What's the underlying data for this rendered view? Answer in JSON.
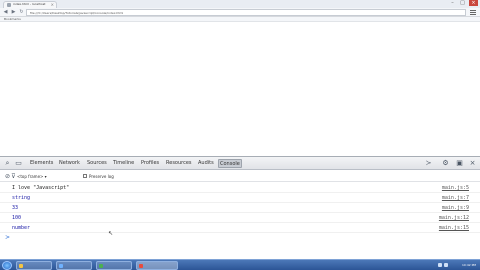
{
  "browser": {
    "tab_title": "index.html - localhost",
    "tab_close": "×",
    "window_controls": {
      "minimize": "–",
      "maximize": "□",
      "close": "×"
    },
    "nav": {
      "back": "◀",
      "forward": "▶",
      "reload": "↻"
    },
    "url": "file:///C:/Users/Desktop/Tutorials/javascript/console/index.html",
    "bookmark": "Bookmarks"
  },
  "devtools": {
    "tabs": [
      "Elements",
      "Network",
      "Sources",
      "Timeline",
      "Profiles",
      "Resources",
      "Audits",
      "Console"
    ],
    "active_tab": "Console",
    "frame_select": "<top frame>",
    "frame_select_arrow": "▾",
    "preserve_log": "Preserve log",
    "prompt_symbol": ">",
    "logs": [
      {
        "text": "I love \"Javascript\"",
        "source": "main.js:5",
        "color": "#222222"
      },
      {
        "text": "string",
        "source": "main.js:7",
        "color": "#1a1aa6"
      },
      {
        "text": "33",
        "source": "main.js:9",
        "color": "#1a1aa6"
      },
      {
        "text": "100",
        "source": "main.js:12",
        "color": "#1a1aa6"
      },
      {
        "text": "number",
        "source": "main.js:15",
        "color": "#1a1aa6"
      }
    ]
  },
  "icons": {
    "search": "⌕",
    "console_drawer": "▭",
    "clear": "⊘",
    "filter": "⊽",
    "execute": "≻",
    "settings": "⚙",
    "dock": "▣",
    "close": "×",
    "cursor": "↖"
  },
  "taskbar": {
    "clock": "10:42 PM",
    "items": [
      {
        "label": "",
        "color": "#f5c542"
      },
      {
        "label": "",
        "color": "#6fb2ff"
      },
      {
        "label": "",
        "color": "#4caf50"
      },
      {
        "label": "",
        "color": "#e94b3c"
      }
    ]
  },
  "colors": {
    "accent": "#2f6fd6",
    "link": "#555555"
  }
}
